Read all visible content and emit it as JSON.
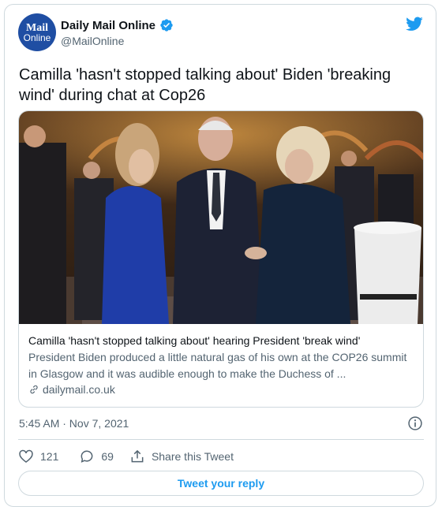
{
  "author": {
    "avatar_top": "Mail",
    "avatar_bottom": "Online",
    "display_name": "Daily Mail Online",
    "handle": "@MailOnline",
    "verified": true
  },
  "tweet": {
    "text": "Camilla 'hasn't stopped talking about' Biden 'breaking wind' during chat at Cop26"
  },
  "link_card": {
    "title": "Camilla 'hasn't stopped talking about' hearing President 'break wind'",
    "description": "President Biden produced a little natural gas of his own at the COP26 summit in Glasgow and it was audible enough to make the Duchess of ...",
    "domain": "dailymail.co.uk"
  },
  "meta": {
    "timestamp": "5:45 AM · Nov 7, 2021"
  },
  "actions": {
    "likes": "121",
    "replies": "69",
    "share_label": "Share this Tweet"
  },
  "reply_button": {
    "label": "Tweet your reply"
  },
  "colors": {
    "accent": "#1d9bf0",
    "like_icon": "#536471",
    "avatar_bg": "#1f4ea3"
  },
  "icons": [
    "verified-badge-icon",
    "twitter-bird-icon",
    "link-icon",
    "info-icon",
    "heart-icon",
    "comment-icon",
    "share-icon"
  ]
}
